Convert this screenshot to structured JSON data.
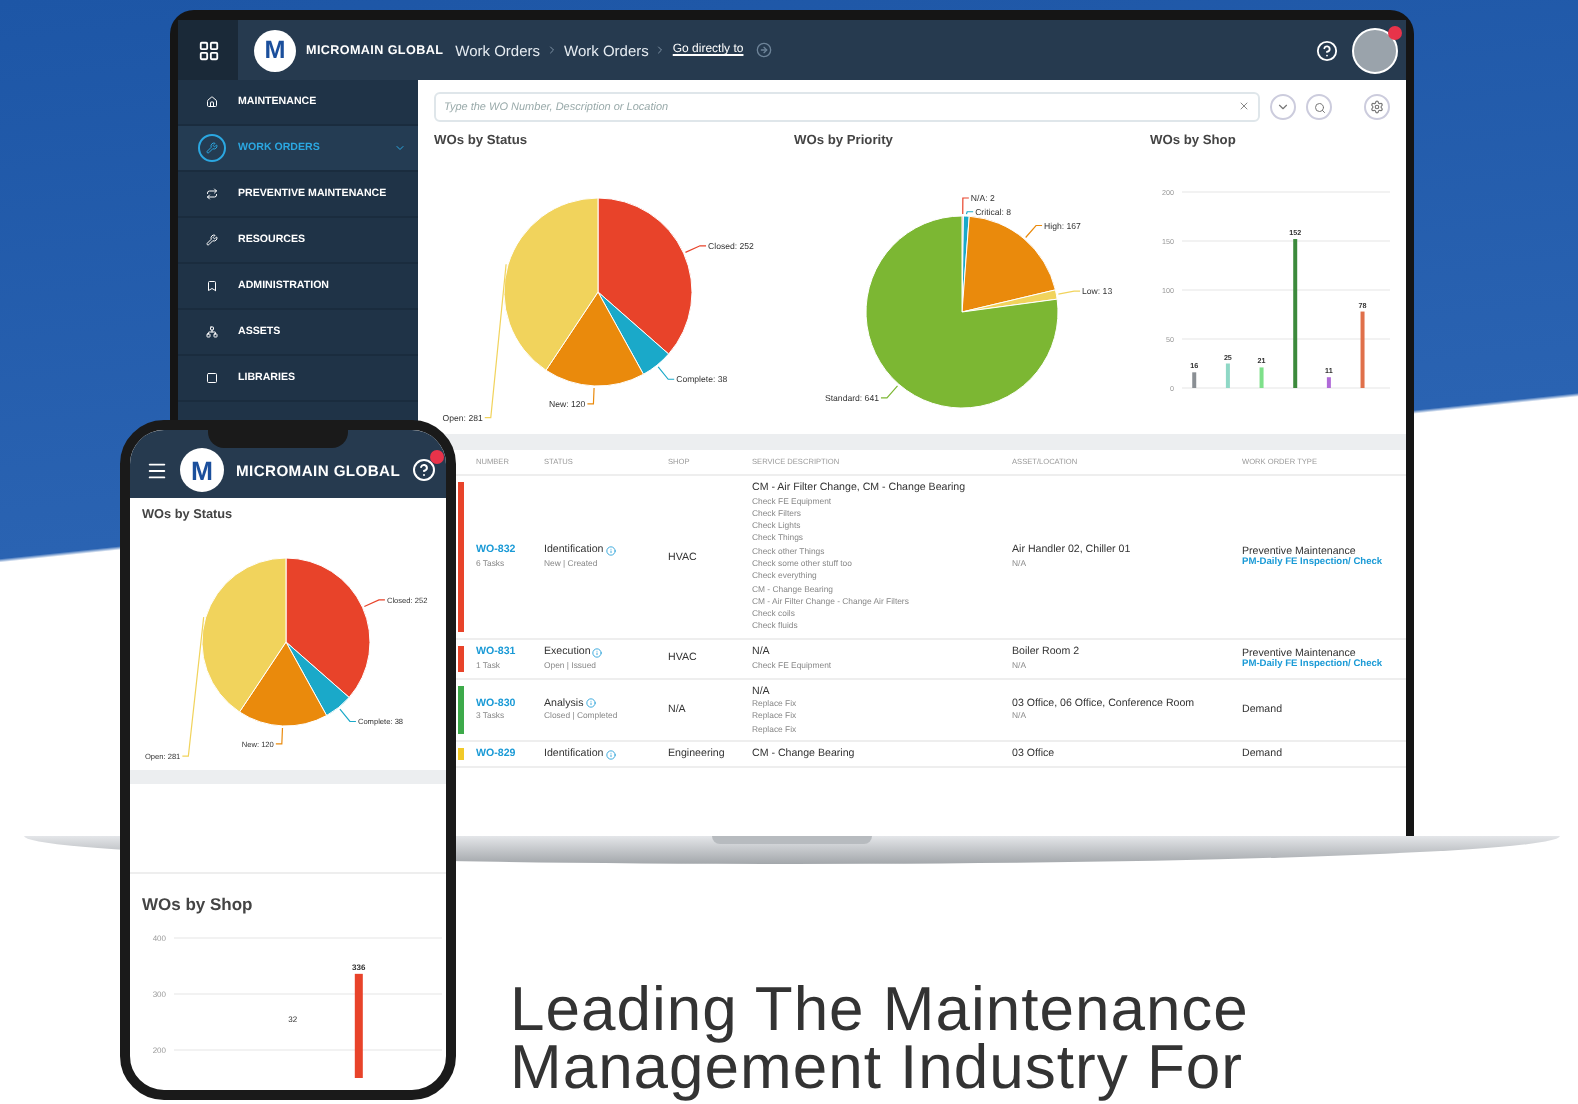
{
  "laptop": {
    "header": {
      "logo": "M",
      "brand": "MICROMAIN GLOBAL",
      "breadcrumbs": [
        "Work Orders",
        "Work Orders"
      ],
      "link": "Go directly to"
    },
    "sidebar": {
      "items": [
        {
          "label": "MAINTENANCE",
          "selected": false
        },
        {
          "label": "WORK ORDERS",
          "selected": true
        },
        {
          "label": "PREVENTIVE MAINTENANCE",
          "selected": false
        },
        {
          "label": "RESOURCES",
          "selected": false
        },
        {
          "label": "ADMINISTRATION",
          "selected": false
        },
        {
          "label": "ASSETS",
          "selected": false
        },
        {
          "label": "LIBRARIES",
          "selected": false
        }
      ]
    },
    "search": {
      "placeholder": "Type the WO Number, Description or Location"
    },
    "charts": [
      {
        "chart_data": {
          "type": "pie",
          "title": "WOs by Status",
          "values": [
            252,
            38,
            120,
            281
          ],
          "value_labels": [
            "Closed: 252",
            "Complete: 38",
            "New: 120",
            "Open: 281"
          ],
          "colors": [
            "#e8432a",
            "#1aa9c9",
            "#ea8a0c",
            "#f1d35c"
          ]
        }
      },
      {
        "chart_data": {
          "type": "pie",
          "title": "WOs by Priority",
          "values": [
            2,
            8,
            167,
            13,
            641
          ],
          "value_labels": [
            "N/A: 2",
            "Critical: 8",
            "High: 167",
            "Low: 13",
            "Standard: 641"
          ],
          "colors": [
            "#e8432a",
            "#1aa9c9",
            "#ea8a0c",
            "#f1d35c",
            "#7cb733"
          ]
        }
      },
      {
        "chart_data": {
          "type": "bar",
          "title": "WOs by Shop",
          "values": [
            16,
            25,
            21,
            152,
            11,
            78
          ],
          "ylim": [
            0,
            200
          ],
          "grid": true,
          "yticks": [
            0,
            50,
            100,
            150,
            200
          ],
          "value_labels": [
            "16",
            "25",
            "21",
            "152",
            "11",
            "78"
          ],
          "colors": [
            "#8a8f94",
            "#8fd8c6",
            "#7ee08a",
            "#3c8a3c",
            "#b06ad8",
            "#e0704a"
          ]
        }
      }
    ],
    "table": {
      "columns": [
        "NUMBER",
        "STATUS",
        "SHOP",
        "SERVICE DESCRIPTION",
        "ASSET/LOCATION",
        "WORK ORDER TYPE"
      ],
      "rows": [
        {
          "color": "#e8432a",
          "number": "WO-832",
          "tasks": "6 Tasks",
          "status": "Identification",
          "status_sub": "New | Created",
          "shop": "HVAC",
          "description": "CM - Air Filter Change, CM - Change Bearing",
          "description_lines": [
            "Check FE Equipment",
            "Check Filters",
            "Check Lights",
            "Check Things",
            "Check other Things",
            "Check some other stuff too",
            "Check everything",
            "CM - Change Bearing",
            "CM - Air Filter Change - Change Air Filters",
            "Check coils",
            "Check fluids"
          ],
          "location": "Air Handler 02, Chiller 01",
          "location_sub": "N/A",
          "type": "Preventive Maintenance",
          "type_link": "PM-Daily FE Inspection/ Check"
        },
        {
          "color": "#e8432a",
          "number": "WO-831",
          "tasks": "1 Task",
          "status": "Execution",
          "status_sub": "Open | Issued",
          "shop": "HVAC",
          "description": "N/A",
          "description_lines": [
            "Check FE Equipment"
          ],
          "location": "Boiler Room 2",
          "location_sub": "N/A",
          "type": "Preventive Maintenance",
          "type_link": "PM-Daily FE Inspection/ Check"
        },
        {
          "color": "#3daa4a",
          "number": "WO-830",
          "tasks": "3 Tasks",
          "status": "Analysis",
          "status_sub": "Closed | Completed",
          "shop": "N/A",
          "description": "N/A",
          "description_lines": [
            "Replace Fix",
            "Replace Fix",
            "Replace Fix"
          ],
          "location": "03 Office, 06 Office, Conference Room",
          "location_sub": "N/A",
          "type": "Demand"
        },
        {
          "color": "#f1c928",
          "number": "WO-829",
          "status": "Identification",
          "shop": "Engineering",
          "description": "CM - Change Bearing",
          "location": "03 Office",
          "type": "Demand"
        }
      ]
    }
  },
  "phone": {
    "header": {
      "logo": "M",
      "brand": "MICROMAIN GLOBAL"
    },
    "status_chart": {
      "chart_data": {
        "type": "pie",
        "title": "WOs by Status",
        "values": [
          252,
          38,
          120,
          281
        ],
        "value_labels": [
          "Closed: 252",
          "Complete: 38",
          "New: 120",
          "Open: 281"
        ],
        "colors": [
          "#e8432a",
          "#1aa9c9",
          "#ea8a0c",
          "#f1d35c"
        ]
      }
    },
    "shop_chart": {
      "chart_data": {
        "type": "bar",
        "title": "WOs by Shop",
        "values": [
          336
        ],
        "ylim": [
          150,
          400
        ],
        "grid": true,
        "yticks": [
          200,
          300,
          400
        ],
        "value_labels": [
          "336"
        ],
        "colors": [
          "#e8432a"
        ],
        "annotations": [
          "32"
        ]
      }
    }
  },
  "headline": "Leading The Maintenance Management Industry For"
}
